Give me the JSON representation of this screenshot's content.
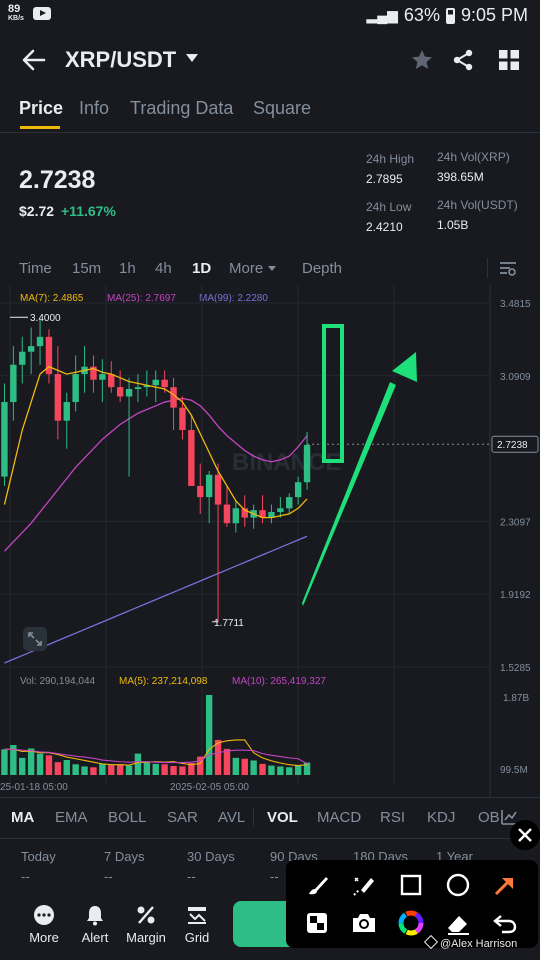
{
  "status": {
    "speed": "89",
    "speed_unit": "KB/s",
    "battery": "63%",
    "time": "9:05 PM"
  },
  "header": {
    "pair": "XRP/USDT"
  },
  "tabs": [
    "Price",
    "Info",
    "Trading Data",
    "Square"
  ],
  "ticker": {
    "price": "2.7238",
    "usd_price": "$2.72",
    "change": "+11.67%",
    "high_label": "24h High",
    "high": "2.7895",
    "low_label": "24h Low",
    "low": "2.4210",
    "vol_xrp_label": "24h Vol(XRP)",
    "vol_xrp": "398.65M",
    "vol_usdt_label": "24h Vol(USDT)",
    "vol_usdt": "1.05B"
  },
  "timeframes": [
    "Time",
    "15m",
    "1h",
    "4h",
    "1D",
    "More",
    "Depth"
  ],
  "ma_legend": {
    "ma7": "MA(7): 2.4865",
    "ma25": "MA(25): 2.7697",
    "ma99": "MA(99): 2.2280"
  },
  "chart_data": {
    "type": "candlestick",
    "y_ticks": [
      "3.4815",
      "3.0909",
      "2.7238",
      "2.3097",
      "1.9192",
      "1.5285"
    ],
    "y_range": [
      1.5285,
      3.4815
    ],
    "last_price": "2.7238",
    "high_marker": "3.4000",
    "low_marker": "1.7711",
    "watermark": "BINANCE",
    "x_labels": [
      "25-01-18 05:00",
      "2025-02-05 05:00"
    ],
    "ohlc": [
      [
        2.55,
        3.05,
        2.5,
        2.95
      ],
      [
        2.95,
        3.25,
        2.85,
        3.15
      ],
      [
        3.15,
        3.3,
        3.05,
        3.22
      ],
      [
        3.22,
        3.35,
        3.1,
        3.25
      ],
      [
        3.25,
        3.4,
        3.15,
        3.3
      ],
      [
        3.3,
        3.34,
        3.05,
        3.1
      ],
      [
        3.1,
        3.25,
        2.75,
        2.85
      ],
      [
        2.85,
        3.0,
        2.7,
        2.95
      ],
      [
        2.95,
        3.2,
        2.9,
        3.1
      ],
      [
        3.1,
        3.25,
        3.0,
        3.14
      ],
      [
        3.14,
        3.2,
        3.0,
        3.07
      ],
      [
        3.07,
        3.18,
        2.95,
        3.1
      ],
      [
        3.1,
        3.17,
        3.0,
        3.03
      ],
      [
        3.03,
        3.12,
        2.95,
        2.98
      ],
      [
        2.98,
        3.08,
        2.55,
        3.02
      ],
      [
        3.02,
        3.1,
        2.95,
        3.03
      ],
      [
        3.03,
        3.12,
        2.98,
        3.04
      ],
      [
        3.04,
        3.12,
        2.95,
        3.07
      ],
      [
        3.07,
        3.12,
        3.0,
        3.03
      ],
      [
        3.03,
        3.08,
        2.8,
        2.92
      ],
      [
        2.92,
        2.98,
        2.75,
        2.8
      ],
      [
        2.8,
        2.88,
        2.55,
        2.5
      ],
      [
        2.5,
        2.62,
        2.35,
        2.44
      ],
      [
        2.44,
        2.58,
        2.3,
        2.56
      ],
      [
        2.56,
        2.62,
        1.77,
        2.4
      ],
      [
        2.4,
        2.5,
        2.28,
        2.3
      ],
      [
        2.3,
        2.42,
        2.25,
        2.38
      ],
      [
        2.38,
        2.45,
        2.28,
        2.33
      ],
      [
        2.33,
        2.4,
        2.27,
        2.37
      ],
      [
        2.37,
        2.45,
        2.3,
        2.33
      ],
      [
        2.33,
        2.4,
        2.3,
        2.36
      ],
      [
        2.36,
        2.44,
        2.33,
        2.38
      ],
      [
        2.38,
        2.46,
        2.35,
        2.44
      ],
      [
        2.44,
        2.55,
        2.4,
        2.52
      ],
      [
        2.52,
        2.79,
        2.48,
        2.72
      ]
    ],
    "ma7": [
      2.4,
      2.6,
      2.8,
      2.95,
      3.1,
      3.14,
      3.12,
      3.1,
      3.11,
      3.12,
      3.13,
      3.11,
      3.1,
      3.08,
      3.06,
      3.05,
      3.04,
      3.03,
      3.02,
      2.99,
      2.95,
      2.88,
      2.78,
      2.68,
      2.58,
      2.5,
      2.42,
      2.37,
      2.35,
      2.33,
      2.33,
      2.34,
      2.35,
      2.38,
      2.43
    ],
    "ma25": [
      2.15,
      2.2,
      2.25,
      2.3,
      2.36,
      2.42,
      2.48,
      2.54,
      2.6,
      2.65,
      2.7,
      2.75,
      2.79,
      2.83,
      2.86,
      2.89,
      2.91,
      2.93,
      2.95,
      2.96,
      2.97,
      2.96,
      2.93,
      2.88,
      2.82,
      2.77,
      2.73,
      2.69,
      2.66,
      2.64,
      2.63,
      2.64,
      2.66,
      2.71,
      2.77
    ],
    "ma99": [
      1.55,
      1.57,
      1.59,
      1.61,
      1.63,
      1.65,
      1.67,
      1.69,
      1.71,
      1.73,
      1.75,
      1.77,
      1.79,
      1.81,
      1.83,
      1.85,
      1.87,
      1.89,
      1.91,
      1.93,
      1.95,
      1.97,
      1.99,
      2.01,
      2.03,
      2.05,
      2.07,
      2.09,
      2.11,
      2.13,
      2.15,
      2.17,
      2.19,
      2.21,
      2.23
    ],
    "volume": {
      "label": "Vol: 290,194,044",
      "ma5_label": "MA(5): 237,214,098",
      "ma10_label": "MA(10): 265,419,327",
      "y_ticks": [
        "1.87B",
        "99.5M"
      ],
      "values_m": [
        600,
        700,
        400,
        620,
        500,
        460,
        300,
        350,
        250,
        200,
        180,
        260,
        230,
        250,
        220,
        500,
        320,
        260,
        250,
        210,
        200,
        280,
        430,
        1870,
        820,
        610,
        400,
        380,
        340,
        260,
        220,
        200,
        180,
        230,
        290
      ],
      "ma5_m": [
        600,
        600,
        550,
        560,
        520,
        520,
        480,
        420,
        380,
        340,
        300,
        260,
        240,
        240,
        230,
        290,
        300,
        310,
        300,
        310,
        270,
        240,
        270,
        600,
        750,
        800,
        820,
        820,
        520,
        400,
        330,
        280,
        240,
        220,
        240
      ],
      "ma10_m": [
        600,
        600,
        580,
        570,
        540,
        530,
        500,
        470,
        440,
        420,
        390,
        350,
        330,
        310,
        300,
        310,
        310,
        300,
        290,
        290,
        290,
        300,
        330,
        470,
        520,
        560,
        580,
        580,
        570,
        500,
        460,
        430,
        400,
        380,
        265
      ]
    }
  },
  "annotation_colors": {
    "up": "#2ebd85",
    "down": "#f6465d",
    "ma7": "#f0b90b",
    "ma25": "#c445c2",
    "ma99": "#7b6fd6",
    "draw": "#1ee07a"
  },
  "indicators": [
    "MA",
    "EMA",
    "BOLL",
    "SAR",
    "AVL",
    "VOL",
    "MACD",
    "RSI",
    "KDJ",
    "OB"
  ],
  "performance": {
    "labels": [
      "Today",
      "7 Days",
      "30 Days",
      "90 Days",
      "180 Days",
      "1 Year"
    ],
    "values": [
      "--",
      "--",
      "--",
      "--",
      "--",
      "--"
    ]
  },
  "bottom_bar": {
    "more": "More",
    "alert": "Alert",
    "margin": "Margin",
    "grid": "Grid",
    "buy": "Bu"
  },
  "credit": "@Alex Harrison"
}
